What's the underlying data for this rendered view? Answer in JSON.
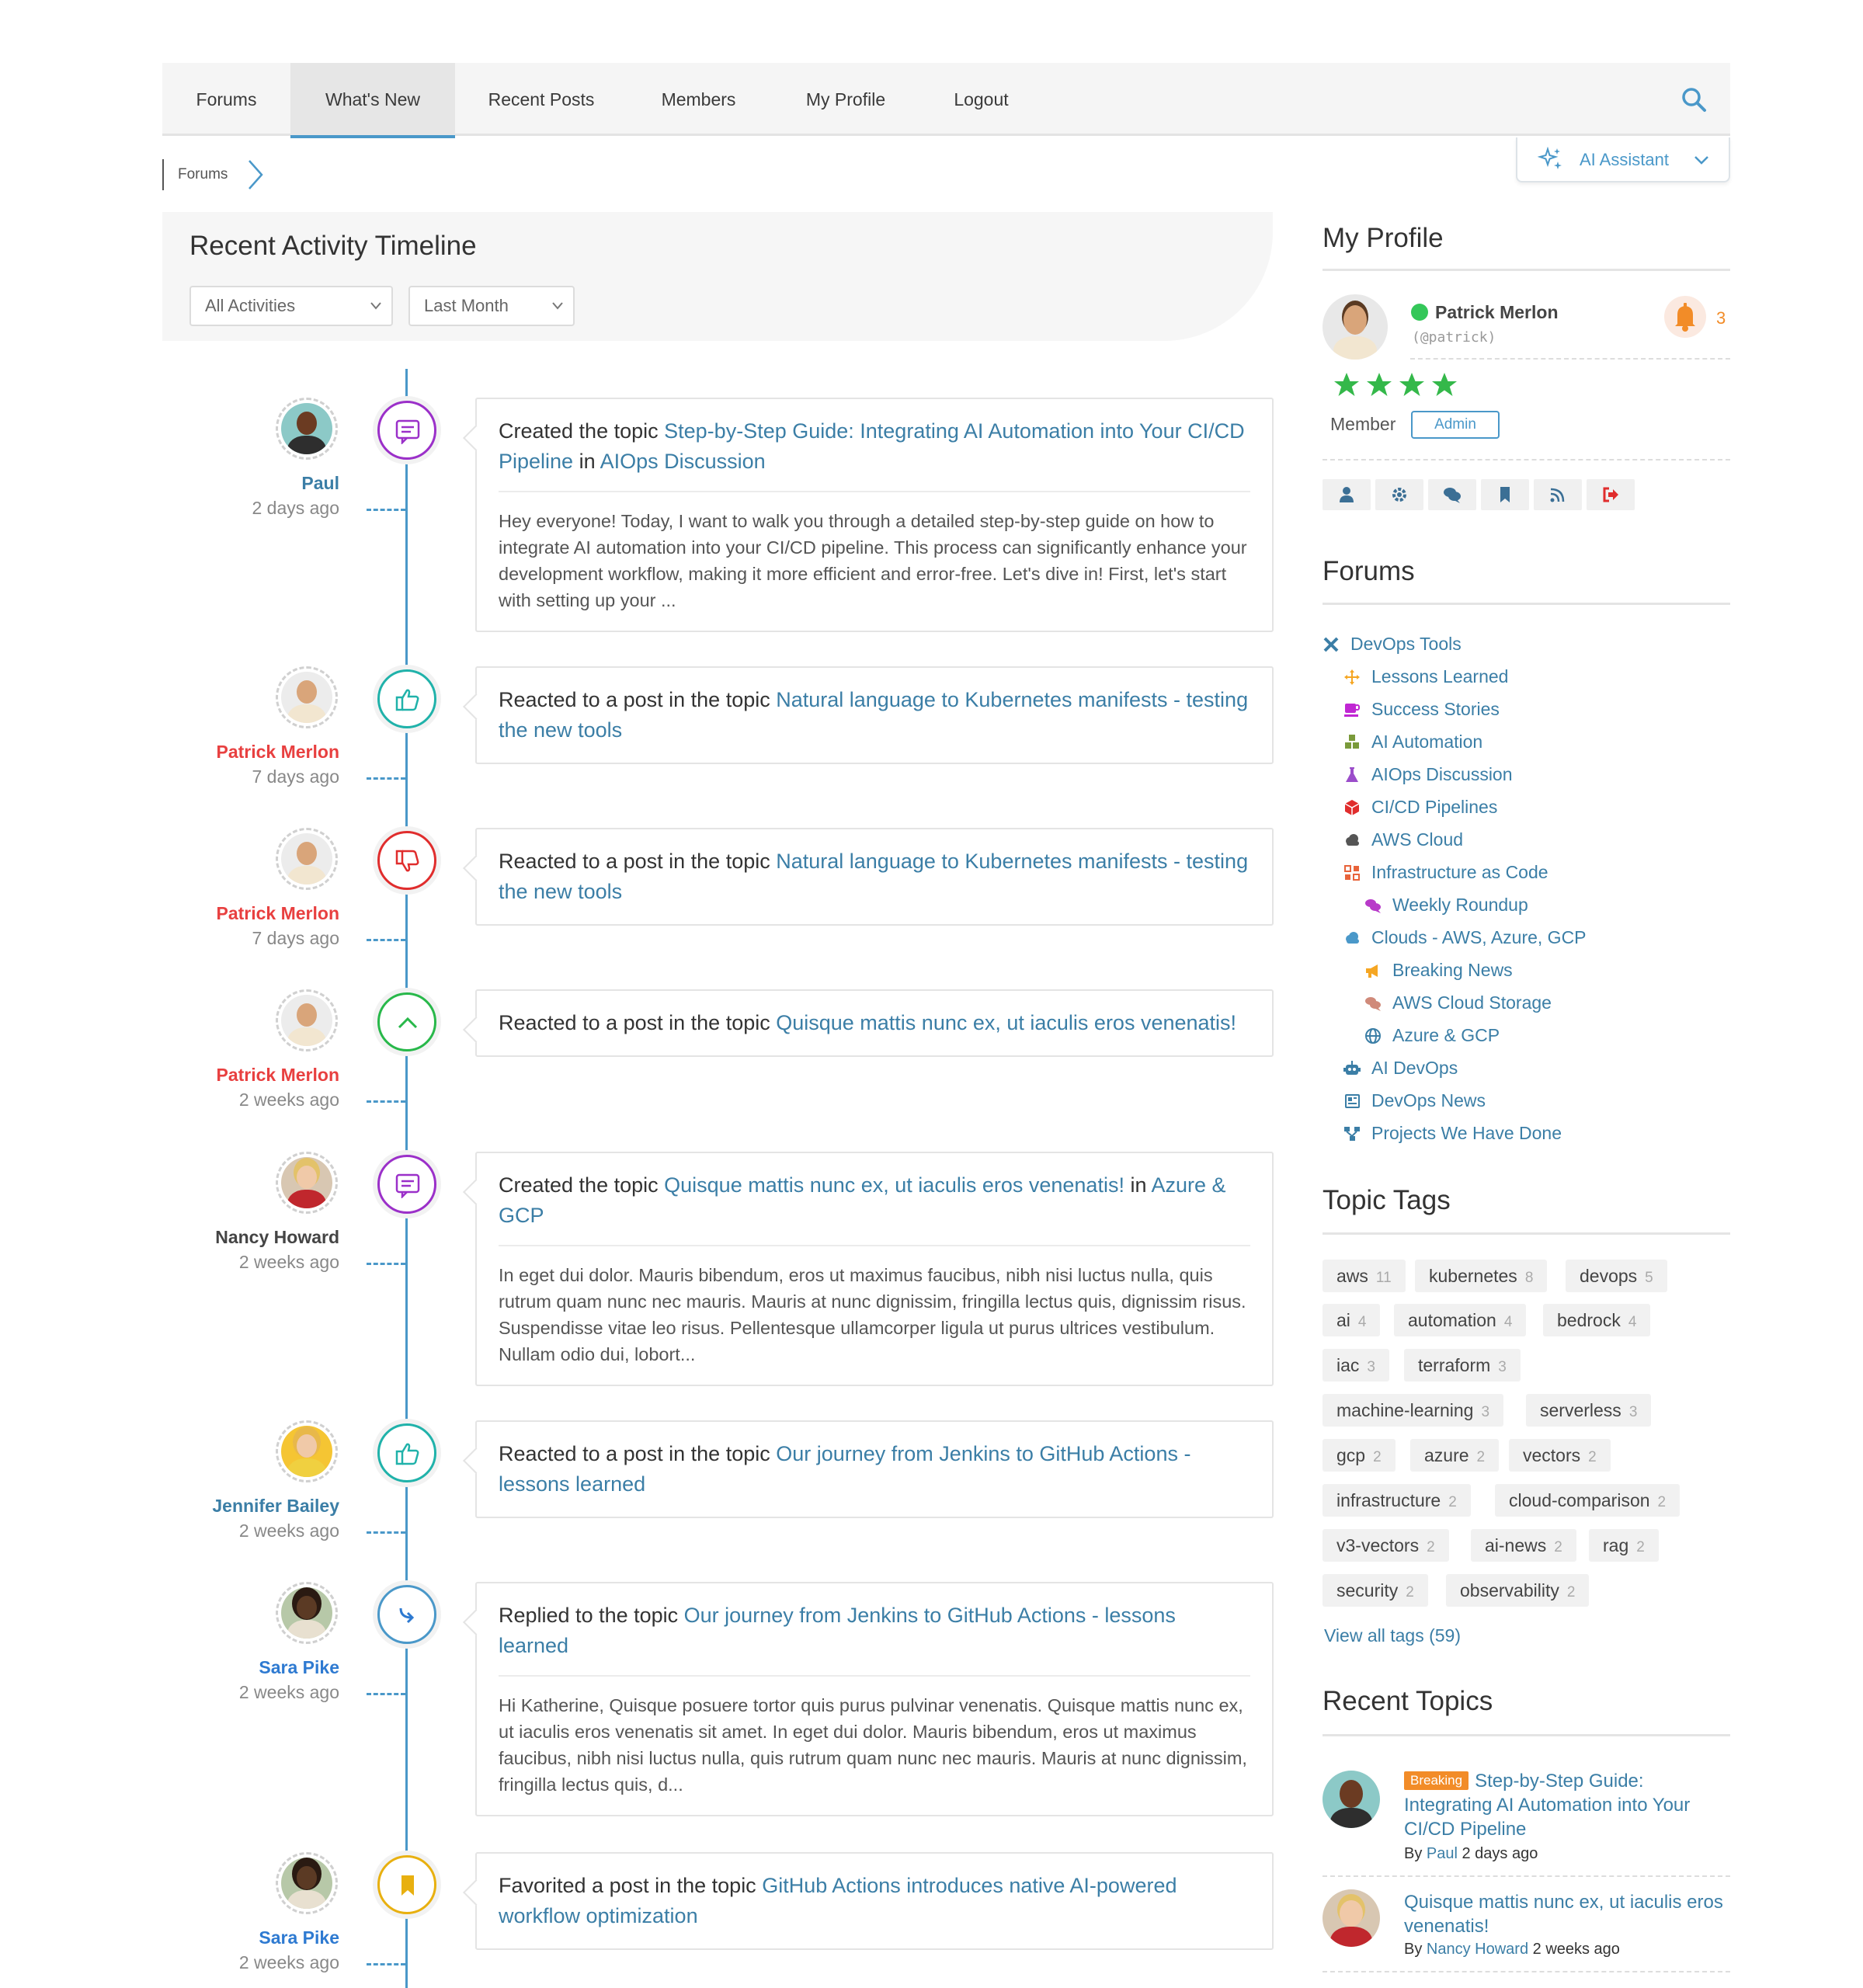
{
  "nav": {
    "items": [
      "Forums",
      "What's New",
      "Recent Posts",
      "Members",
      "My Profile",
      "Logout"
    ],
    "active": "What's New"
  },
  "breadcrumb": {
    "label": "Forums"
  },
  "ai_assistant": {
    "label": "AI Assistant"
  },
  "activity": {
    "title": "Recent Activity Timeline",
    "filter_type": "All Activities",
    "filter_period": "Last Month",
    "entries": [
      {
        "user": "Paul",
        "time": "2 days ago",
        "icon": "comment-icon",
        "prefix": "Created the topic ",
        "topic": "Step-by-Step Guide: Integrating AI Automation into Your CI/CD Pipeline",
        "middle": " in ",
        "forum": "AIOps Discussion",
        "excerpt": "Hey everyone! Today, I want to walk you through a detailed step-by-step guide on how to integrate AI automation into your CI/CD pipeline. This process can significantly enhance your development workflow, making it more efficient and error-free. Let's dive in! First, let's start with setting up your ..."
      },
      {
        "user": "Patrick Merlon",
        "time": "7 days ago",
        "icon": "thumbs-up-icon",
        "prefix": "Reacted to a post in the topic ",
        "topic": "Natural language to Kubernetes manifests - testing the new tools"
      },
      {
        "user": "Patrick Merlon",
        "time": "7 days ago",
        "icon": "thumbs-down-icon",
        "prefix": "Reacted to a post in the topic ",
        "topic": "Natural language to Kubernetes manifests - testing the new tools"
      },
      {
        "user": "Patrick Merlon",
        "time": "2 weeks ago",
        "icon": "upvote-icon",
        "prefix": "Reacted to a post in the topic ",
        "topic": "Quisque mattis nunc ex, ut iaculis eros venenatis!"
      },
      {
        "user": "Nancy Howard",
        "time": "2 weeks ago",
        "icon": "comment-icon",
        "prefix": "Created the topic ",
        "topic": "Quisque mattis nunc ex, ut iaculis eros venenatis!",
        "middle": " in ",
        "forum": "Azure & GCP",
        "excerpt": "In eget dui dolor. Mauris bibendum, eros ut maximus faucibus, nibh nisi luctus nulla, quis rutrum quam nunc nec mauris. Mauris at nunc dignissim, fringilla lectus quis, dignissim risus. Suspendisse vitae leo risus. Pellentesque ullamcorper ligula ut purus ultrices vestibulum. Nullam odio dui, lobort..."
      },
      {
        "user": "Jennifer Bailey",
        "time": "2 weeks ago",
        "icon": "thumbs-up-icon",
        "prefix": "Reacted to a post in the topic ",
        "topic": "Our journey from Jenkins to GitHub Actions - lessons learned"
      },
      {
        "user": "Sara Pike",
        "time": "2 weeks ago",
        "icon": "reply-icon",
        "prefix": "Replied to the topic ",
        "topic": "Our journey from Jenkins to GitHub Actions - lessons learned",
        "excerpt": "Hi Katherine, Quisque posuere tortor quis purus pulvinar venenatis. Quisque mattis nunc ex, ut iaculis eros venenatis sit amet. In eget dui dolor. Mauris bibendum, eros ut maximus faucibus, nibh nisi luctus nulla, quis rutrum quam nunc nec mauris. Mauris at nunc dignissim, fringilla lectus quis, d..."
      },
      {
        "user": "Sara Pike",
        "time": "2 weeks ago",
        "icon": "bookmark-icon",
        "prefix": "Favorited a post in the topic ",
        "topic": "GitHub Actions introduces native AI-powered workflow optimization"
      }
    ]
  },
  "profile": {
    "title": "My Profile",
    "name": "Patrick Merlon",
    "handle": "(@patrick)",
    "notifications": "3",
    "role": "Member",
    "badge": "Admin",
    "stars": 4,
    "actions": [
      "user-icon",
      "settings-icon",
      "chat-icon",
      "bookmark-icon",
      "rss-icon",
      "logout-icon"
    ]
  },
  "forums": {
    "title": "Forums",
    "items": [
      {
        "label": "DevOps Tools",
        "icon": "tools-icon",
        "color": "#3b7ea6"
      },
      {
        "label": "Lessons Learned",
        "icon": "arrows-icon",
        "color": "#f5a623"
      },
      {
        "label": "Success Stories",
        "icon": "mug-icon",
        "color": "#c026d3"
      },
      {
        "label": "AI Automation",
        "icon": "cubes-icon",
        "color": "#7a9a3a"
      },
      {
        "label": "AIOps Discussion",
        "icon": "flask-icon",
        "color": "#9b4dca"
      },
      {
        "label": "CI/CD Pipelines",
        "icon": "cube-icon",
        "color": "#e02d2d"
      },
      {
        "label": "AWS Cloud",
        "icon": "cloud-icon",
        "color": "#555555"
      },
      {
        "label": "Infrastructure as Code",
        "icon": "grid-icon",
        "color": "#e8633a"
      },
      {
        "label": "Weekly Roundup",
        "icon": "comments-icon",
        "color": "#b83ac9"
      },
      {
        "label": "Clouds - AWS, Azure, GCP",
        "icon": "cloud-icon",
        "color": "#4a98c9"
      },
      {
        "label": "Breaking News",
        "icon": "megaphone-icon",
        "color": "#f5a623"
      },
      {
        "label": "AWS Cloud Storage",
        "icon": "comments-icon",
        "color": "#d08a7a"
      },
      {
        "label": "Azure & GCP",
        "icon": "globe-icon",
        "color": "#3b7ea6"
      },
      {
        "label": "AI DevOps",
        "icon": "robot-icon",
        "color": "#3b7ea6"
      },
      {
        "label": "DevOps News",
        "icon": "newspaper-icon",
        "color": "#3b7ea6"
      },
      {
        "label": "Projects We Have Done",
        "icon": "sitemap-icon",
        "color": "#3b7ea6"
      }
    ]
  },
  "tags": {
    "title": "Topic Tags",
    "items": [
      {
        "name": "aws",
        "count": "11"
      },
      {
        "name": "kubernetes",
        "count": "8"
      },
      {
        "name": "devops",
        "count": "5"
      },
      {
        "name": "ai",
        "count": "4"
      },
      {
        "name": "automation",
        "count": "4"
      },
      {
        "name": "bedrock",
        "count": "4"
      },
      {
        "name": "iac",
        "count": "3"
      },
      {
        "name": "terraform",
        "count": "3"
      },
      {
        "name": "machine-learning",
        "count": "3"
      },
      {
        "name": "serverless",
        "count": "3"
      },
      {
        "name": "gcp",
        "count": "2"
      },
      {
        "name": "azure",
        "count": "2"
      },
      {
        "name": "vectors",
        "count": "2"
      },
      {
        "name": "infrastructure",
        "count": "2"
      },
      {
        "name": "cloud-comparison",
        "count": "2"
      },
      {
        "name": "v3-vectors",
        "count": "2"
      },
      {
        "name": "ai-news",
        "count": "2"
      },
      {
        "name": "rag",
        "count": "2"
      },
      {
        "name": "security",
        "count": "2"
      },
      {
        "name": "observability",
        "count": "2"
      }
    ],
    "view_all": "View all tags (59)"
  },
  "recent_topics": {
    "title": "Recent Topics",
    "items": [
      {
        "badge": "Breaking",
        "title": "Step-by-Step Guide: Integrating AI Automation into Your CI/CD Pipeline",
        "by": "By ",
        "user": "Paul",
        "time": " 2 days ago"
      },
      {
        "title": "Quisque mattis nunc ex, ut iaculis eros venenatis!",
        "by": "By ",
        "user": "Nancy Howard",
        "time": " 2 weeks ago"
      }
    ]
  },
  "colors": {
    "accent": "#4a98c9",
    "link": "#3b7ea6",
    "comment": "#9b30c9",
    "like": "#20b2aa",
    "dislike": "#e02d2d",
    "upvote": "#28b84a",
    "reply": "#4a98c9",
    "bookmark": "#e8b010"
  }
}
